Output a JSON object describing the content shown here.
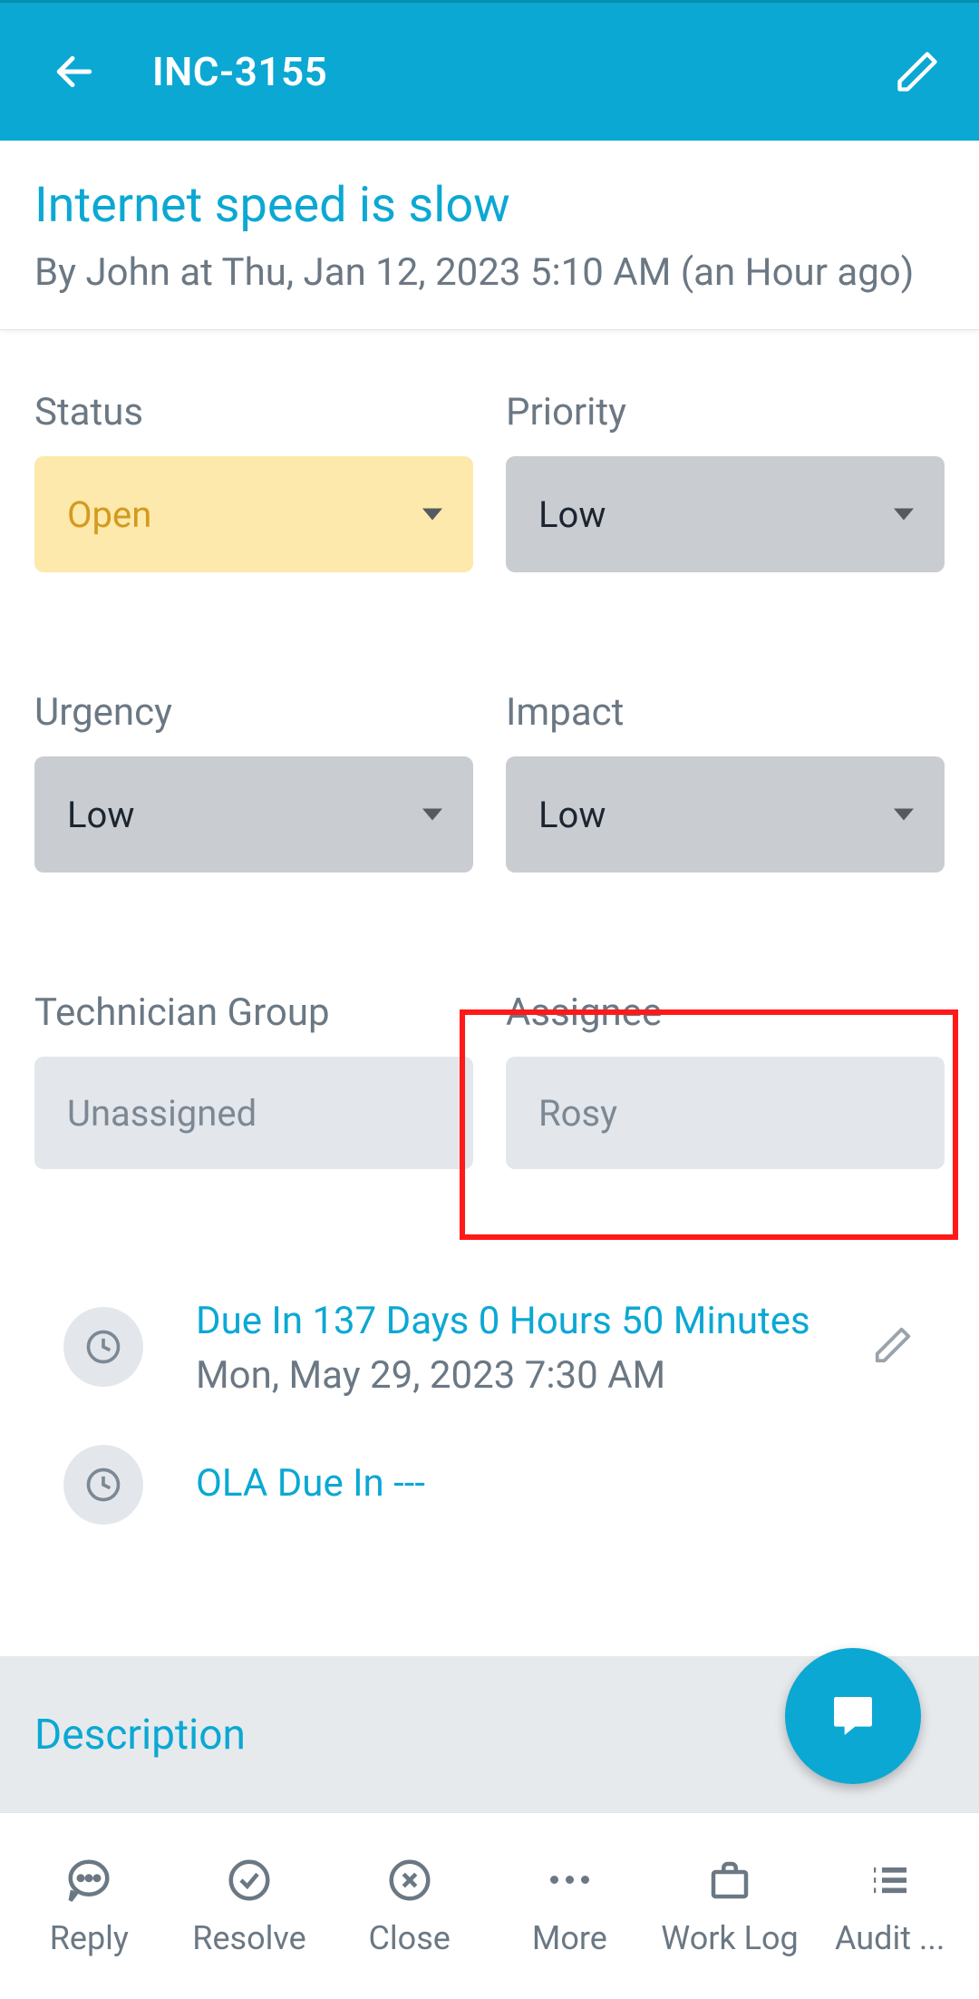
{
  "header": {
    "title": "INC-3155"
  },
  "ticket": {
    "title": "Internet speed is slow",
    "meta": "By John at Thu, Jan 12, 2023 5:10 AM (an Hour ago)"
  },
  "fields": {
    "status": {
      "label": "Status",
      "value": "Open"
    },
    "priority": {
      "label": "Priority",
      "value": "Low"
    },
    "urgency": {
      "label": "Urgency",
      "value": "Low"
    },
    "impact": {
      "label": "Impact",
      "value": "Low"
    },
    "group": {
      "label": "Technician Group",
      "value": "Unassigned"
    },
    "assignee": {
      "label": "Assignee",
      "value": "Rosy"
    }
  },
  "due": {
    "main": "Due In 137 Days 0 Hours 50 Minutes",
    "sub": "Mon, May 29, 2023 7:30 AM",
    "ola": "OLA Due In ---"
  },
  "sections": {
    "description": "Description"
  },
  "nav": {
    "reply": "Reply",
    "resolve": "Resolve",
    "close": "Close",
    "more": "More",
    "worklog": "Work Log",
    "audit": "Audit ..."
  }
}
